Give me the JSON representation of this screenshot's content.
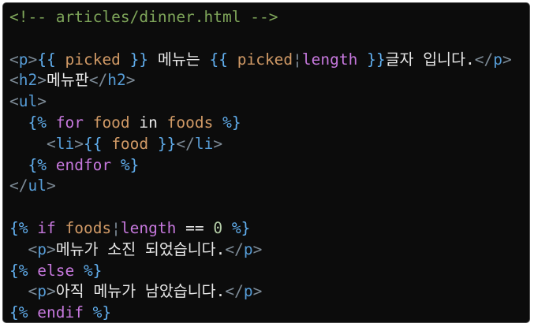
{
  "editor": {
    "lines": [
      [
        {
          "t": "<!-- articles/dinner.html -->",
          "c": "comment"
        }
      ],
      [],
      [
        {
          "t": "<",
          "c": "punct"
        },
        {
          "t": "p",
          "c": "tag"
        },
        {
          "t": ">",
          "c": "punct"
        },
        {
          "t": "{{ ",
          "c": "tmpl"
        },
        {
          "t": "picked",
          "c": "var"
        },
        {
          "t": " }}",
          "c": "tmpl"
        },
        {
          "t": " 메뉴는 ",
          "c": "text"
        },
        {
          "t": "{{ ",
          "c": "tmpl"
        },
        {
          "t": "picked",
          "c": "var"
        },
        {
          "t": "¦",
          "c": "punct"
        },
        {
          "t": "length",
          "c": "keyword"
        },
        {
          "t": " }}",
          "c": "tmpl"
        },
        {
          "t": "글자 입니다.",
          "c": "text"
        },
        {
          "t": "</",
          "c": "punct"
        },
        {
          "t": "p",
          "c": "tag"
        },
        {
          "t": ">",
          "c": "punct"
        }
      ],
      [
        {
          "t": "<",
          "c": "punct"
        },
        {
          "t": "h2",
          "c": "tag"
        },
        {
          "t": ">",
          "c": "punct"
        },
        {
          "t": "메뉴판",
          "c": "text"
        },
        {
          "t": "</",
          "c": "punct"
        },
        {
          "t": "h2",
          "c": "tag"
        },
        {
          "t": ">",
          "c": "punct"
        }
      ],
      [
        {
          "t": "<",
          "c": "punct"
        },
        {
          "t": "ul",
          "c": "tag"
        },
        {
          "t": ">",
          "c": "punct"
        }
      ],
      [
        {
          "t": "  ",
          "c": "text"
        },
        {
          "t": "{% ",
          "c": "tmpl"
        },
        {
          "t": "for",
          "c": "keyword"
        },
        {
          "t": " ",
          "c": "text"
        },
        {
          "t": "food",
          "c": "var"
        },
        {
          "t": " in ",
          "c": "text"
        },
        {
          "t": "foods",
          "c": "var"
        },
        {
          "t": " %}",
          "c": "tmpl"
        }
      ],
      [
        {
          "t": "    ",
          "c": "text"
        },
        {
          "t": "<",
          "c": "punct"
        },
        {
          "t": "li",
          "c": "tag"
        },
        {
          "t": ">",
          "c": "punct"
        },
        {
          "t": "{{ ",
          "c": "tmpl"
        },
        {
          "t": "food",
          "c": "var"
        },
        {
          "t": " }}",
          "c": "tmpl"
        },
        {
          "t": "</",
          "c": "punct"
        },
        {
          "t": "li",
          "c": "tag"
        },
        {
          "t": ">",
          "c": "punct"
        }
      ],
      [
        {
          "t": "  ",
          "c": "text"
        },
        {
          "t": "{% ",
          "c": "tmpl"
        },
        {
          "t": "endfor",
          "c": "keyword"
        },
        {
          "t": " %}",
          "c": "tmpl"
        }
      ],
      [
        {
          "t": "</",
          "c": "punct"
        },
        {
          "t": "ul",
          "c": "tag"
        },
        {
          "t": ">",
          "c": "punct"
        }
      ],
      [],
      [
        {
          "t": "{% ",
          "c": "tmpl"
        },
        {
          "t": "if",
          "c": "keyword"
        },
        {
          "t": " ",
          "c": "text"
        },
        {
          "t": "foods",
          "c": "var"
        },
        {
          "t": "¦",
          "c": "punct"
        },
        {
          "t": "length",
          "c": "keyword"
        },
        {
          "t": " == ",
          "c": "text"
        },
        {
          "t": "0",
          "c": "number"
        },
        {
          "t": " %}",
          "c": "tmpl"
        }
      ],
      [
        {
          "t": "  ",
          "c": "text"
        },
        {
          "t": "<",
          "c": "punct"
        },
        {
          "t": "p",
          "c": "tag"
        },
        {
          "t": ">",
          "c": "punct"
        },
        {
          "t": "메뉴가 소진 되었습니다.",
          "c": "text"
        },
        {
          "t": "</",
          "c": "punct"
        },
        {
          "t": "p",
          "c": "tag"
        },
        {
          "t": ">",
          "c": "punct"
        }
      ],
      [
        {
          "t": "{% ",
          "c": "tmpl"
        },
        {
          "t": "else",
          "c": "keyword"
        },
        {
          "t": " %}",
          "c": "tmpl"
        }
      ],
      [
        {
          "t": "  ",
          "c": "text"
        },
        {
          "t": "<",
          "c": "punct"
        },
        {
          "t": "p",
          "c": "tag"
        },
        {
          "t": ">",
          "c": "punct"
        },
        {
          "t": "아직 메뉴가 남았습니다.",
          "c": "text"
        },
        {
          "t": "</",
          "c": "punct"
        },
        {
          "t": "p",
          "c": "tag"
        },
        {
          "t": ">",
          "c": "punct"
        }
      ],
      [
        {
          "t": "{% ",
          "c": "tmpl"
        },
        {
          "t": "endif",
          "c": "keyword"
        },
        {
          "t": " %}",
          "c": "tmpl"
        }
      ]
    ]
  }
}
